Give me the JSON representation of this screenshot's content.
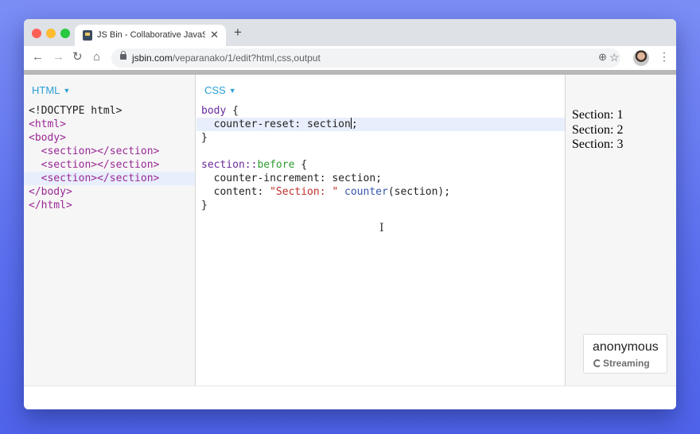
{
  "browser": {
    "tab_title": "JS Bin - Collaborative JavaScript Debugging",
    "tab_close": "✕",
    "new_tab": "+",
    "url_host": "jsbin.com",
    "url_path": "/veparanako/1/edit?html,css,output"
  },
  "icons": {
    "back": "←",
    "forward": "→",
    "reload": "↻",
    "home": "⌂",
    "zoom": "⊕",
    "star": "☆",
    "menu": "⋮"
  },
  "panes": {
    "html": {
      "label": "HTML",
      "lines": [
        "<!DOCTYPE html>",
        "<html>",
        "<body>",
        "  <section></section>",
        "  <section></section>",
        "  <section></section>",
        "</body>",
        "</html>"
      ]
    },
    "css": {
      "label": "CSS",
      "line1_sel": "body",
      "line1_rest": " {",
      "line2_prop": "  counter-reset: section",
      "line2_end": ";",
      "line3": "}",
      "line5_sel": "section::",
      "line5_pseudo": "before",
      "line5_rest": " {",
      "line6": "  counter-increment: section;",
      "line7_prop": "  content: ",
      "line7_str": "\"Section: \"",
      "line7_fn": " counter",
      "line7_rest": "(section);",
      "line8": "}"
    },
    "output": {
      "lines": [
        "Section: 1",
        "Section: 2",
        "Section: 3"
      ]
    }
  },
  "badge": {
    "name": "anonymous",
    "status": "Streaming"
  },
  "colors": {
    "accent": "#2a9fd6",
    "tag": "#9a2896",
    "string": "#c0302a",
    "pseudo": "#2f9a2f"
  }
}
